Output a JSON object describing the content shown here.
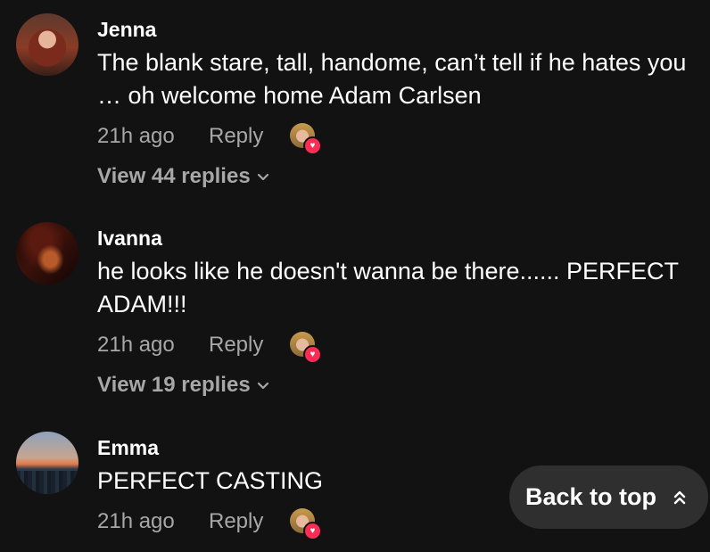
{
  "comments": [
    {
      "username": "Jenna",
      "text": "The blank stare, tall, handome, can’t tell if he hates you … oh welcome home Adam Carlsen",
      "time": "21h ago",
      "reply_label": "Reply",
      "view_replies": "View 44 replies"
    },
    {
      "username": "Ivanna",
      "text": "he looks like he doesn't wanna be there...... PERFECT ADAM!!!",
      "time": "21h ago",
      "reply_label": "Reply",
      "view_replies": "View 19 replies"
    },
    {
      "username": "Emma",
      "text": "PERFECT CASTING",
      "time": "21h ago",
      "reply_label": "Reply"
    }
  ],
  "back_to_top": {
    "label": "Back to top",
    "icon": "double-chevron-up-icon"
  },
  "icons": {
    "liked_by_creator": "heart-icon",
    "expand": "chevron-down-icon"
  },
  "colors": {
    "background": "#121212",
    "primary_text": "#ffffff",
    "secondary_text": "#a7a7a7",
    "heart": "#fe2c55",
    "button_bg": "#2f2f2f"
  }
}
